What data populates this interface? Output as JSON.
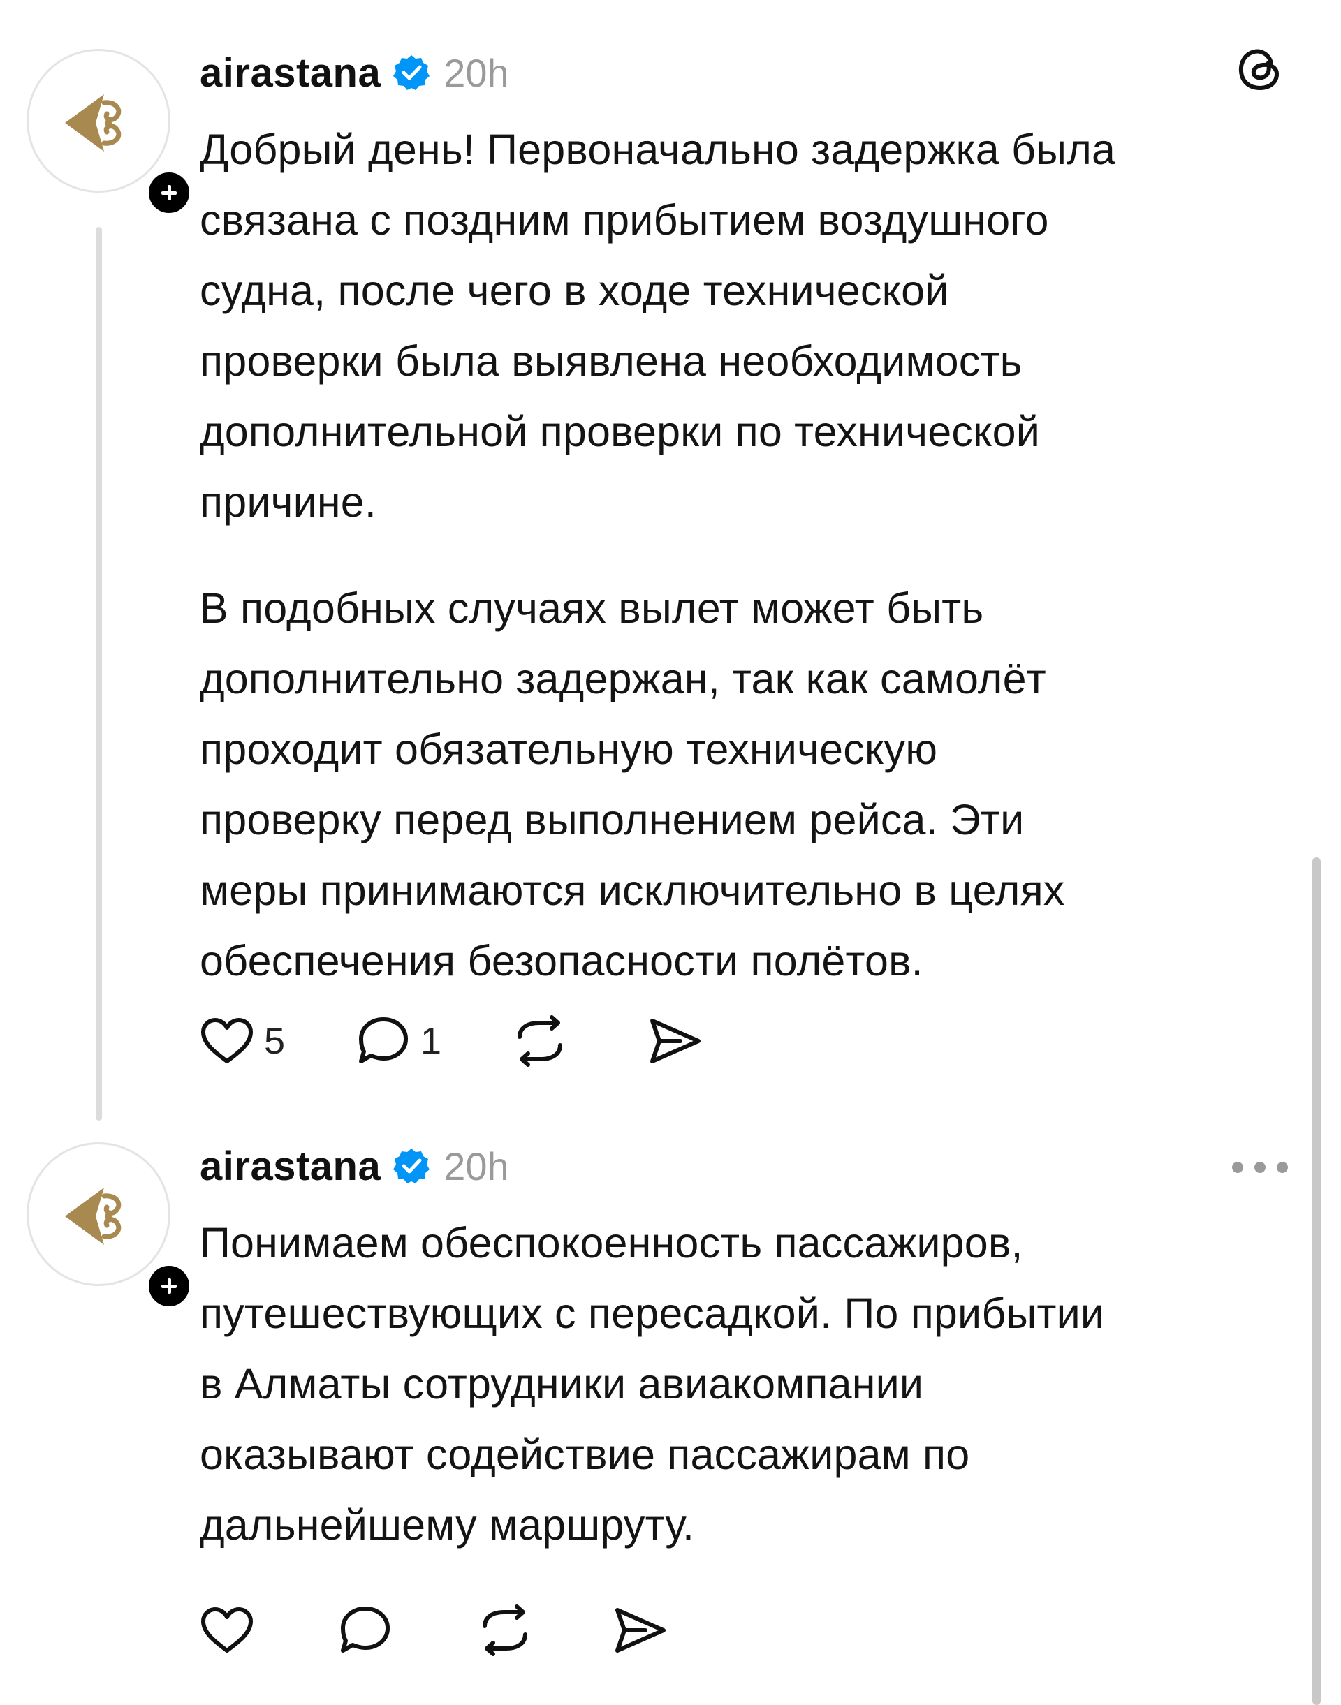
{
  "posts": [
    {
      "username": "airastana",
      "time": "20h",
      "paragraphs": [
        "Добрый день! Первоначально задержка была\nсвязана с поздним прибытием воздушного\nсудна, после чего в ходе технической\nпроверки была выявлена необходимость\nдополнительной проверки по технической\nпричине.",
        "В подобных случаях вылет может быть\nдополнительно задержан, так как самолёт\nпроходит обязательную техническую\nпроверку перед выполнением рейса. Эти\nмеры принимаются исключительно в целях\nобеспечения безопасности полётов."
      ],
      "likes": "5",
      "replies": "1"
    },
    {
      "username": "airastana",
      "time": "20h",
      "paragraphs": [
        "Понимаем обеспокоенность пассажиров,\nпутешествующих с пересадкой. По прибытии\nв Алматы сотрудники авиакомпании\nоказывают содействие пассажирам по\nдальнейшему маршруту."
      ]
    }
  ],
  "icons": {
    "threads_logo": "threads-logo-icon",
    "verified": "verified-badge-icon",
    "like": "heart-icon",
    "reply": "speech-bubble-icon",
    "repost": "repost-icon",
    "share": "send-icon",
    "more": "more-dots-icon",
    "follow": "plus-icon"
  },
  "colors": {
    "verified_blue": "#0095f6",
    "logo_gold": "#a8894f",
    "text": "#141414",
    "muted": "#9a9a9a",
    "thread_line": "#dcdcdc"
  }
}
